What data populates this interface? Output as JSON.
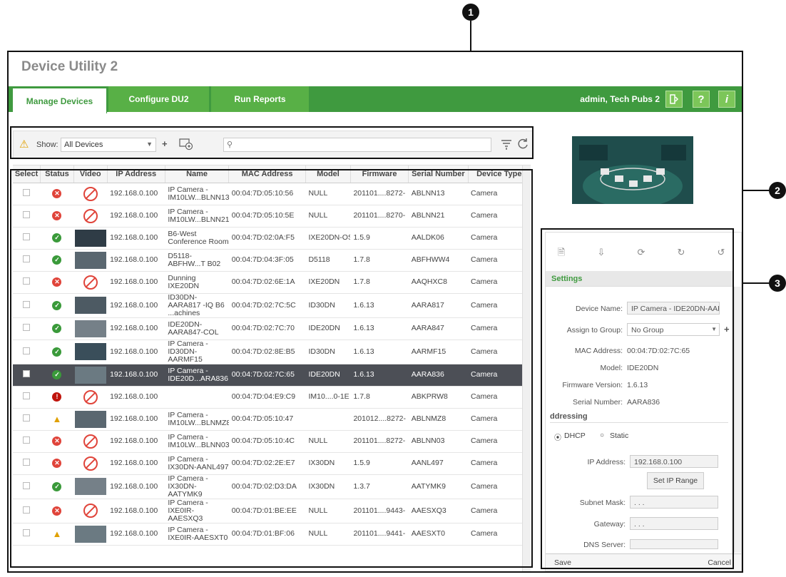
{
  "callouts": [
    "1",
    "2",
    "3"
  ],
  "app": {
    "title": "Device Utility 2",
    "tabs": [
      "Manage Devices",
      "Configure DU2",
      "Run Reports"
    ],
    "user": "admin, Tech Pubs 2",
    "help_label": "?",
    "info_label": "i"
  },
  "toolbar": {
    "show_label": "Show:",
    "show_value": "All Devices",
    "add_label": "+",
    "search_placeholder": ""
  },
  "grid": {
    "columns": [
      "Select",
      "Status",
      "Video",
      "IP Address",
      "Name",
      "MAC Address",
      "Model",
      "Firmware",
      "Serial Number",
      "Device Type"
    ],
    "rows": [
      {
        "status": "error",
        "video": "none",
        "ip": "192.168.0.100",
        "name": "IP Camera - IM10LW...BLNN13",
        "mac": "00:04:7D:05:10:56",
        "model": "NULL",
        "fw": "201101....8272-",
        "serial": "ABLNN13",
        "type": "Camera"
      },
      {
        "status": "error",
        "video": "none",
        "ip": "192.168.0.100",
        "name": "IP Camera - IM10LW...BLNN21",
        "mac": "00:04:7D:05:10:5E",
        "model": "NULL",
        "fw": "201101....8270-",
        "serial": "ABLNN21",
        "type": "Camera"
      },
      {
        "status": "ok",
        "video": "thumb",
        "ip": "192.168.0.100",
        "name": "B6-West Conference Room",
        "mac": "00:04:7D:02:0A:F5",
        "model": "IXE20DN-OS",
        "fw": "1.5.9",
        "serial": "AALDK06",
        "type": "Camera"
      },
      {
        "status": "ok",
        "video": "thumb",
        "ip": "192.168.0.100",
        "name": "D5118-ABFHW...T B02",
        "mac": "00:04:7D:04:3F:05",
        "model": "D5118",
        "fw": "1.7.8",
        "serial": "ABFHWW4",
        "type": "Camera"
      },
      {
        "status": "error",
        "video": "none",
        "ip": "192.168.0.100",
        "name": "Dunning IXE20DN",
        "mac": "00:04:7D:02:6E:1A",
        "model": "IXE20DN",
        "fw": "1.7.8",
        "serial": "AAQHXC8",
        "type": "Camera"
      },
      {
        "status": "ok",
        "video": "thumb",
        "ip": "192.168.0.100",
        "name": "ID30DN-AARA817 -IQ B6 ...achines",
        "mac": "00:04:7D:02:7C:5C",
        "model": "ID30DN",
        "fw": "1.6.13",
        "serial": "AARA817",
        "type": "Camera"
      },
      {
        "status": "ok",
        "video": "thumb",
        "ip": "192.168.0.100",
        "name": "IDE20DN-AARA847-COL",
        "mac": "00:04:7D:02:7C:70",
        "model": "IDE20DN",
        "fw": "1.6.13",
        "serial": "AARA847",
        "type": "Camera"
      },
      {
        "status": "ok",
        "video": "thumb",
        "ip": "192.168.0.100",
        "name": "IP Camera - ID30DN-AARMF15",
        "mac": "00:04:7D:02:8E:B5",
        "model": "ID30DN",
        "fw": "1.6.13",
        "serial": "AARMF15",
        "type": "Camera"
      },
      {
        "status": "ok",
        "video": "thumb",
        "ip": "192.168.0.100",
        "name": "IP Camera - IDE20D...ARA836",
        "mac": "00:04:7D:02:7C:65",
        "model": "IDE20DN",
        "fw": "1.6.13",
        "serial": "AARA836",
        "type": "Camera",
        "selected": true
      },
      {
        "status": "severe",
        "video": "none",
        "ip": "192.168.0.100",
        "name": "",
        "mac": "00:04:7D:04:E9:C9",
        "model": "IM10....0-1E",
        "fw": "1.7.8",
        "serial": "ABKPRW8",
        "type": "Camera"
      },
      {
        "status": "warn",
        "video": "thumb",
        "ip": "192.168.0.100",
        "name": "IP Camera - IM10LW...BLNMZ8",
        "mac": "00:04:7D:05:10:47",
        "model": "",
        "fw": "201012....8272-",
        "serial": "ABLNMZ8",
        "type": "Camera"
      },
      {
        "status": "error",
        "video": "none",
        "ip": "192.168.0.100",
        "name": "IP Camera - IM10LW...BLNN03",
        "mac": "00:04:7D:05:10:4C",
        "model": "NULL",
        "fw": "201101....8272-",
        "serial": "ABLNN03",
        "type": "Camera"
      },
      {
        "status": "error",
        "video": "none",
        "ip": "192.168.0.100",
        "name": "IP Camera - IX30DN-AANL497",
        "mac": "00:04:7D:02:2E:E7",
        "model": "IX30DN",
        "fw": "1.5.9",
        "serial": "AANL497",
        "type": "Camera"
      },
      {
        "status": "ok",
        "video": "thumb",
        "ip": "192.168.0.100",
        "name": "IP Camera - IX30DN-AATYMK9",
        "mac": "00:04:7D:02:D3:DA",
        "model": "IX30DN",
        "fw": "1.3.7",
        "serial": "AATYMK9",
        "type": "Camera"
      },
      {
        "status": "error",
        "video": "none",
        "ip": "192.168.0.100",
        "name": "IP Camera - IXE0IR-AAESXQ3",
        "mac": "00:04:7D:01:BE:EE",
        "model": "NULL",
        "fw": "201101....9443-",
        "serial": "AAESXQ3",
        "type": "Camera"
      },
      {
        "status": "warn",
        "video": "thumb",
        "ip": "192.168.0.100",
        "name": "IP Camera - IXE0IR-AAESXT0",
        "mac": "00:04:7D:01:BF:06",
        "model": "NULL",
        "fw": "201101....9441-",
        "serial": "AAESXT0",
        "type": "Camera"
      }
    ]
  },
  "panel": {
    "section_title": "Settings",
    "device_name_label": "Device Name:",
    "device_name_value": "IP Camera - IDE20DN-AAR/",
    "group_label": "Assign to Group:",
    "group_value": "No Group",
    "mac_label": "MAC Address:",
    "mac_value": "00:04:7D:02:7C:65",
    "model_label": "Model:",
    "model_value": "IDE20DN",
    "fw_label": "Firmware Version:",
    "fw_value": "1.6.13",
    "serial_label": "Serial Number:",
    "serial_value": "AARA836",
    "addressing_title": "ddressing",
    "dhcp_label": "DHCP",
    "static_label": "Static",
    "ip_label": "IP Address:",
    "ip_value": "192.168.0.100",
    "ip_range_button": "Set IP Range",
    "subnet_label": "Subnet Mask:",
    "subnet_value": ". . .",
    "gateway_label": "Gateway:",
    "gateway_value": ". . .",
    "dns_label": "DNS Server:",
    "save_label": "Save",
    "cancel_label": "Cancel"
  }
}
